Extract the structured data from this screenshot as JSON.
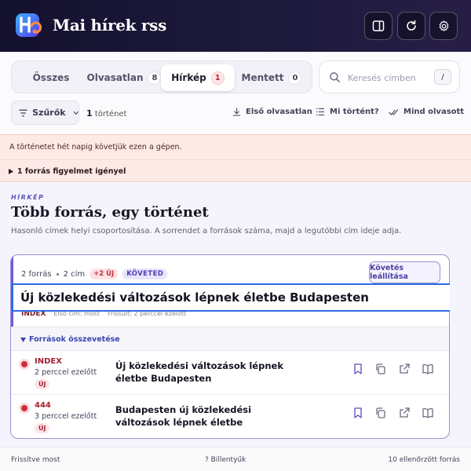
{
  "header": {
    "title": "Mai hírek rss",
    "logo_icon": "app-logo",
    "buttons": [
      {
        "icon": "sidebar-panel-icon"
      },
      {
        "icon": "refresh-icon"
      },
      {
        "icon": "settings-gear-icon"
      }
    ]
  },
  "tabs": [
    {
      "label": "Összes",
      "count": null,
      "active": false
    },
    {
      "label": "Olvasatlan",
      "count": "8",
      "active": false
    },
    {
      "label": "Hírkép",
      "count": "1",
      "active": true
    },
    {
      "label": "Mentett",
      "count": "0",
      "active": false
    }
  ],
  "search": {
    "placeholder": "Keresés címben",
    "shortcut": "/"
  },
  "toolbar": {
    "filter_label": "Szűrők",
    "story_count": "1",
    "story_count_label": "történet",
    "actions": [
      "Első olvasatlan",
      "Mi történt?",
      "Mind olvasott"
    ]
  },
  "banners": {
    "tracking_notice": "A történetet hét napig követjük ezen a gépen.",
    "attention": "1 forrás figyelmet igényel"
  },
  "section": {
    "eyebrow": "HÍRKÉP",
    "title": "Több forrás, egy történet",
    "subtitle": "Hasonló címek helyi csoportosítása. A sorrendet a források száma, majd a legutóbbi cím ideje adja."
  },
  "story": {
    "source_count": "2 forrás",
    "title_count": "2 cím",
    "new_badge": "+2 ÚJ",
    "followed_badge": "KÖVETED",
    "stop_button": "Követés leállítása",
    "headline": "Új közlekedési változások lépnek életbe Budapesten",
    "first_source": "INDEX",
    "first_title_label": "Első cím: most",
    "refreshed_label": "Frissült: 2 perccel ezelőtt",
    "compare_label": "Források összevetése",
    "sources": [
      {
        "name": "INDEX",
        "time": "2 perccel ezelőtt",
        "badge": "ÚJ",
        "title": "Új közlekedési változások lépnek életbe Budapesten"
      },
      {
        "name": "444",
        "time": "3 perccel ezelőtt",
        "badge": "ÚJ",
        "title": "Budapesten új közlekedési változások lépnek életbe"
      }
    ]
  },
  "footer": {
    "left": "Frissítve most",
    "center": "? Billentyűk",
    "right": "10 ellenőrzött forrás"
  },
  "colors": {
    "header_bg": "#1a1738",
    "accent": "#6d5fd3",
    "alert_bg": "#fde9e5",
    "new_red": "#c02d3e",
    "focus_blue": "#2d6be4"
  }
}
